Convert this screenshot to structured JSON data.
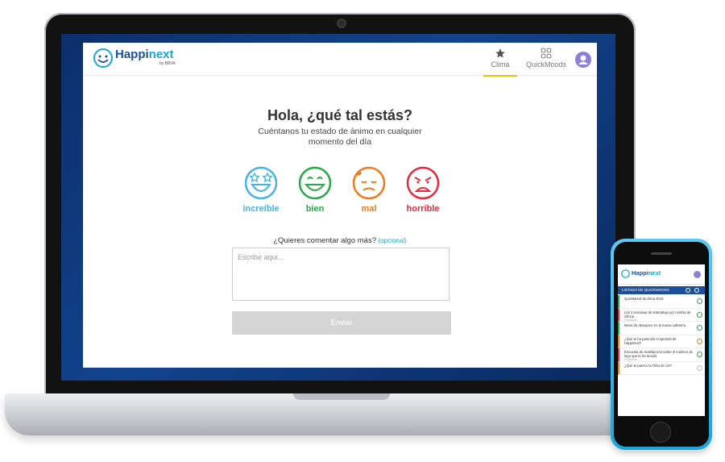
{
  "app": {
    "brand_happi": "Happi",
    "brand_next": "next",
    "brand_sub": "by BBVA",
    "tabs": [
      {
        "label": "Clima",
        "icon": "star-icon",
        "active": true
      },
      {
        "label": "QuickMoods",
        "icon": "grid-icon",
        "active": false
      }
    ],
    "greeting": "Hola, ¿qué tal estás?",
    "subtitle": "Cuéntanos tu estado de ánimo en cualquier momento del día",
    "moods": [
      {
        "label": "increíble",
        "color": "#4ab3e6",
        "icon": "star-eyes-face-icon"
      },
      {
        "label": "bien",
        "color": "#2aa84a",
        "icon": "smile-face-icon"
      },
      {
        "label": "mal",
        "color": "#f07a1e",
        "icon": "sad-face-icon"
      },
      {
        "label": "horrible",
        "color": "#e62a3c",
        "icon": "angry-face-icon"
      }
    ],
    "comment_question": "¿Quieres comentar algo más?",
    "comment_optional": "(opcional)",
    "comment_placeholder": "Escribe aquí...",
    "send_label": "Enviar"
  },
  "phone": {
    "brand_happi": "Happi",
    "brand_next": "next",
    "list_title": "LISTADO DE QUICKMOODS",
    "items": [
      {
        "title": "QuickMood de clima 2019",
        "meta": "",
        "color": "#2aa84a"
      },
      {
        "title": "Los 2 semanas de teletrabajo por cambio de oficina",
        "meta": "Finalizado",
        "color": "#e62a3c"
      },
      {
        "title": "Menú de desayuno en la nueva cafetería",
        "meta": "",
        "color": "#2aa84a"
      },
      {
        "title": "¿Qué te ha parecido el sprint10 de Happinext?",
        "meta": "",
        "color": "#f07a1e"
      },
      {
        "title": "Encuesta de Satisfacción sobre el muñeco de lego que te ha tocado",
        "meta": "Finalizado",
        "color": "#e62a3c"
      },
      {
        "title": "¿Qué te parece la Tribu de UX?",
        "meta": "",
        "color": "#f07a1e"
      }
    ]
  }
}
